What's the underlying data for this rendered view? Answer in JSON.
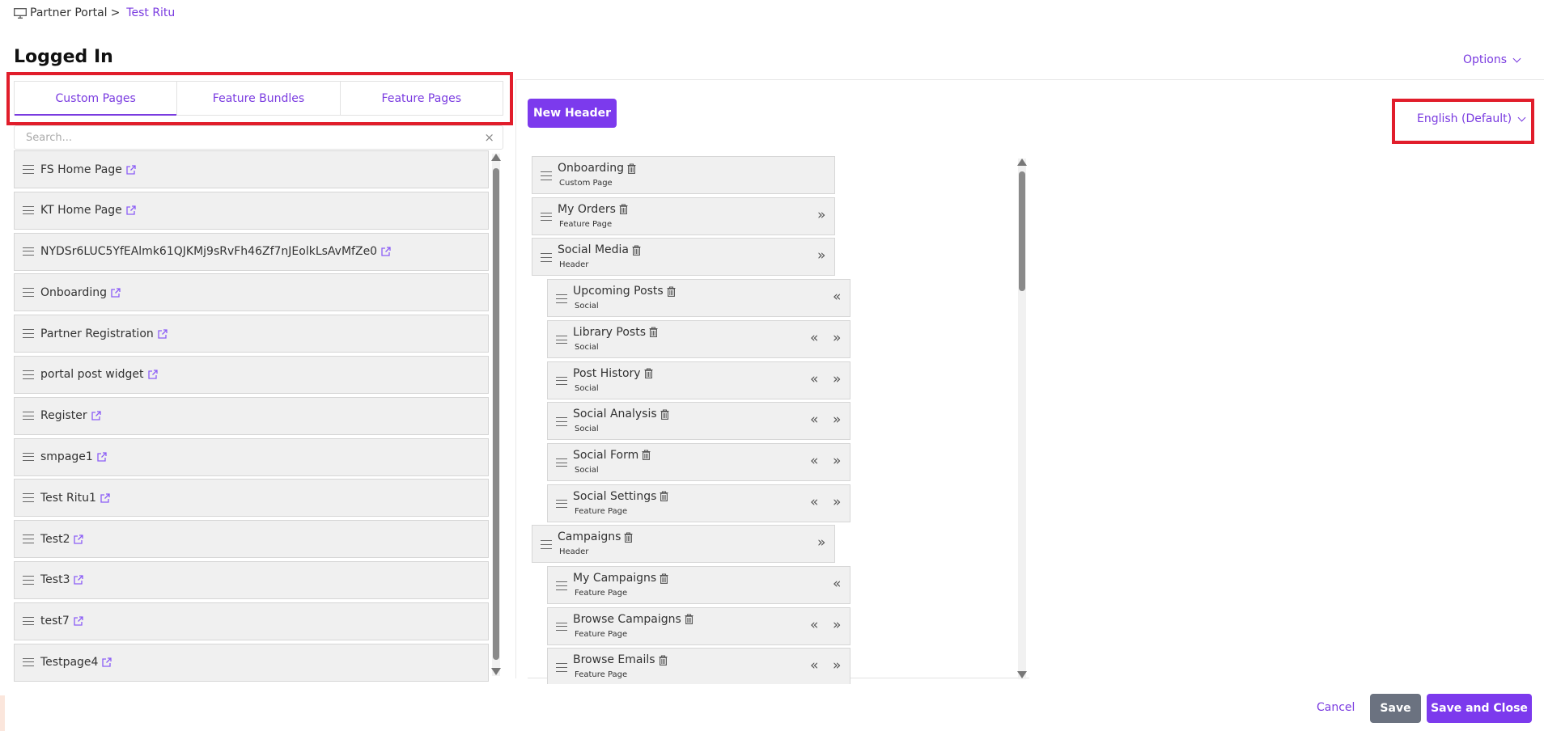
{
  "breadcrumb": {
    "root": "Partner Portal",
    "separator": ">",
    "current": "Test Ritu"
  },
  "page_title": "Logged In",
  "options_label": "Options",
  "tabs": [
    {
      "label": "Custom Pages",
      "active": true
    },
    {
      "label": "Feature Bundles",
      "active": false
    },
    {
      "label": "Feature Pages",
      "active": false
    }
  ],
  "search": {
    "placeholder": "Search...",
    "value": ""
  },
  "custom_pages": [
    "FS Home Page",
    "KT Home Page",
    "NYDSr6LUC5YfEAlmk61QJKMj9sRvFh46Zf7nJEolkLsAvMfZe0",
    "Onboarding",
    "Partner Registration",
    "portal post widget",
    "Register",
    "smpage1",
    "Test Ritu1",
    "Test2",
    "Test3",
    "test7",
    "Testpage4"
  ],
  "new_header_label": "New Header",
  "language_label": "English (Default)",
  "menu_tree": [
    {
      "name": "Onboarding",
      "type": "Custom Page",
      "level": 0,
      "left": false,
      "right": false
    },
    {
      "name": "My Orders",
      "type": "Feature Page",
      "level": 0,
      "left": false,
      "right": true
    },
    {
      "name": "Social Media",
      "type": "Header",
      "level": 0,
      "left": false,
      "right": true
    },
    {
      "name": "Upcoming Posts",
      "type": "Social",
      "level": 1,
      "left": true,
      "right": false
    },
    {
      "name": "Library Posts",
      "type": "Social",
      "level": 1,
      "left": true,
      "right": true
    },
    {
      "name": "Post History",
      "type": "Social",
      "level": 1,
      "left": true,
      "right": true
    },
    {
      "name": "Social Analysis",
      "type": "Social",
      "level": 1,
      "left": true,
      "right": true
    },
    {
      "name": "Social Form",
      "type": "Social",
      "level": 1,
      "left": true,
      "right": true
    },
    {
      "name": "Social Settings",
      "type": "Feature Page",
      "level": 1,
      "left": true,
      "right": true
    },
    {
      "name": "Campaigns",
      "type": "Header",
      "level": 0,
      "left": false,
      "right": true
    },
    {
      "name": "My Campaigns",
      "type": "Feature Page",
      "level": 1,
      "left": true,
      "right": false
    },
    {
      "name": "Browse Campaigns",
      "type": "Feature Page",
      "level": 1,
      "left": true,
      "right": true
    },
    {
      "name": "Browse Emails",
      "type": "Feature Page",
      "level": 1,
      "left": true,
      "right": true
    }
  ],
  "icons": {
    "left_chevron": "«",
    "right_chevron": "»",
    "clear": "×"
  },
  "footer": {
    "cancel_label": "Cancel",
    "save_label": "Save",
    "save_close_label": "Save and Close"
  },
  "colors": {
    "accent": "#7c3aed",
    "link": "#7a3be0",
    "highlight": "#e11d2b",
    "neutral_button": "#6b7280"
  }
}
